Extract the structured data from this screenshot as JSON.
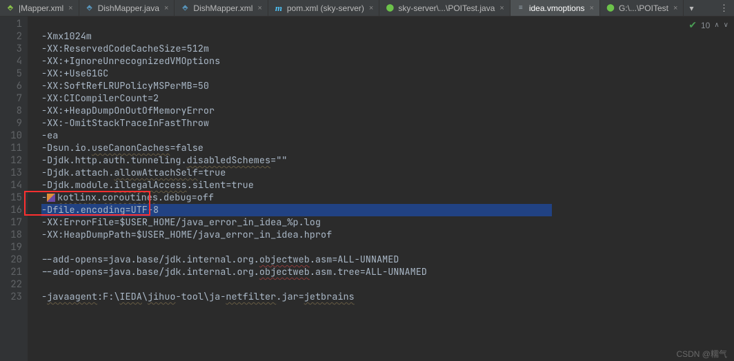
{
  "tabs": [
    {
      "icon": "xml",
      "label": "|Mapper.xml"
    },
    {
      "icon": "java",
      "label": "DishMapper.java"
    },
    {
      "icon": "java",
      "label": "DishMapper.xml"
    },
    {
      "icon": "pom",
      "label": "pom.xml (sky-server)"
    },
    {
      "icon": "green",
      "label": "sky-server\\...\\POITest.java"
    },
    {
      "icon": "txt",
      "label": "idea.vmoptions",
      "active": true
    },
    {
      "icon": "green",
      "label": "G:\\...\\POITest"
    }
  ],
  "status": {
    "count": "10"
  },
  "gutter_start": 1,
  "gutter_end": 23,
  "lines": [
    "",
    "-Xmx1024m",
    "-XX:ReservedCodeCacheSize=512m",
    "-XX:+IgnoreUnrecognizedVMOptions",
    "-XX:+UseG1GC",
    "-XX:SoftRefLRUPolicyMSPerMB=50",
    "-XX:CICompilerCount=2",
    "-XX:+HeapDumpOnOutOfMemoryError",
    "-XX:-OmitStackTraceInFastThrow",
    "-ea",
    "-Dsun.io.useCanonCaches=false",
    "-Djdk.http.auth.tunneling.disabledSchemes=\"\"",
    "-Djdk.attach.allowAttachSelf=true",
    "-Djdk.module.illegalAccess.silent=true",
    "-[KT]kotlinx.coroutines.debug=off",
    "-Dfile.encoding=UTF-8",
    "-XX:ErrorFile=$USER_HOME/java_error_in_idea_%p.log",
    "-XX:HeapDumpPath=$USER_HOME/java_error_in_idea.hprof",
    "",
    "--add-opens=java.base/jdk.internal.org.objectweb.asm=ALL-UNNAMED",
    "--add-opens=java.base/jdk.internal.org.objectweb.asm.tree=ALL-UNNAMED",
    "",
    "-javaagent:F:\\IEDA\\jihuo-tool\\ja-netfilter.jar=jetbrains"
  ],
  "highlight_index": 15,
  "watermark": "CSDN @糯气"
}
